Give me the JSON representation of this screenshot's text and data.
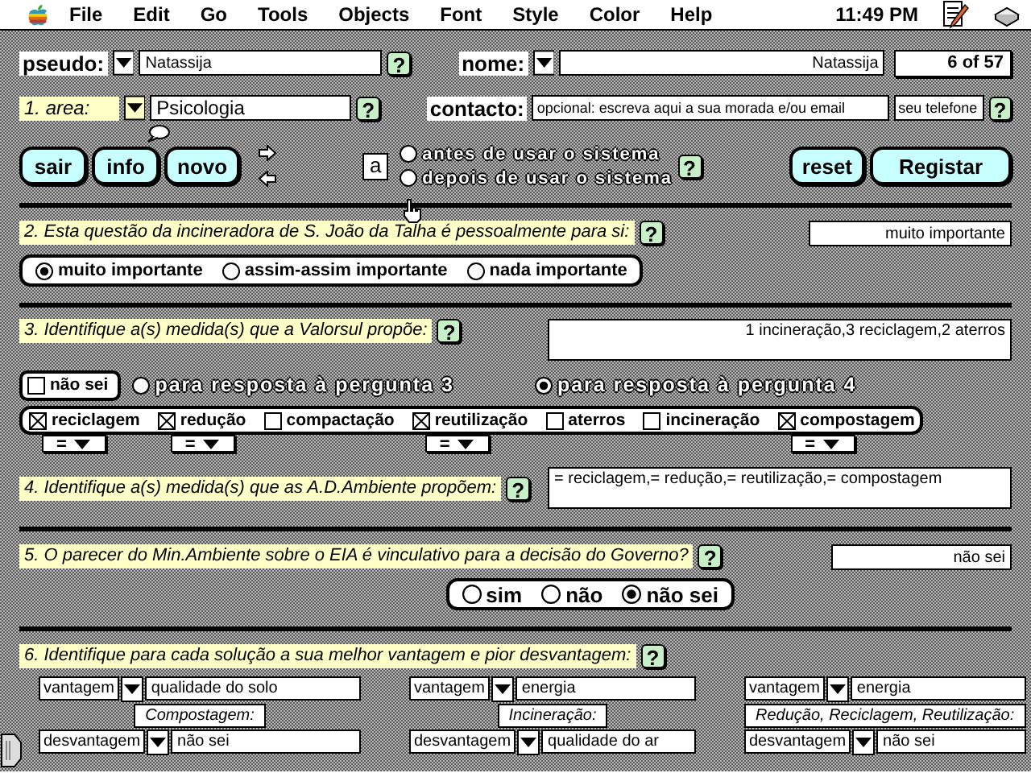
{
  "menubar": {
    "menus": [
      "File",
      "Edit",
      "Go",
      "Tools",
      "Objects",
      "Font",
      "Style",
      "Color",
      "Help"
    ],
    "clock": "11:49 PM"
  },
  "identity": {
    "pseudo_label": "pseudo:",
    "pseudo": "Natassija",
    "pseudo_help": "?",
    "nome_label": "nome:",
    "nome": "Natassija",
    "record_counter": "6 of 57"
  },
  "area": {
    "label": "1. area:",
    "value": "Psicologia",
    "help": "?"
  },
  "contacto": {
    "label": "contacto:",
    "address": "opcional: escreva aqui a sua morada e/ou email",
    "phone": "seu telefone",
    "help": "?"
  },
  "actions": [
    "sair",
    "info",
    "novo"
  ],
  "timing": {
    "marker": "a",
    "help": "?",
    "options": [
      {
        "label": "antes de usar o sistema",
        "selected": false
      },
      {
        "label": "depois de usar o sistema",
        "selected": false
      }
    ]
  },
  "right_actions": [
    "reset",
    "Registar"
  ],
  "q2": {
    "text": "2. Esta questão da incineradora de S. João da Talha é pessoalmente para si:",
    "help": "?",
    "answer": "muito importante",
    "options": [
      {
        "label": "muito importante",
        "selected": true
      },
      {
        "label": "assim-assim importante",
        "selected": false
      },
      {
        "label": "nada importante",
        "selected": false
      }
    ]
  },
  "q3": {
    "text": "3. Identifique a(s) medida(s) que a Valorsul propõe:",
    "help": "?",
    "answer": "1 incineração,3 reciclagem,2 aterros"
  },
  "measures": {
    "nao_sei": {
      "label": "não sei",
      "checked": false
    },
    "targets": [
      {
        "label": "para resposta à pergunta 3",
        "selected": false
      },
      {
        "label": "para resposta à pergunta 4",
        "selected": true
      }
    ],
    "items": [
      {
        "label": "reciclagem",
        "checked": true,
        "operator": "="
      },
      {
        "label": "redução",
        "checked": true,
        "operator": "="
      },
      {
        "label": "compactação",
        "checked": false
      },
      {
        "label": "reutilização",
        "checked": true,
        "operator": "="
      },
      {
        "label": "aterros",
        "checked": false
      },
      {
        "label": "incineração",
        "checked": false
      },
      {
        "label": "compostagem",
        "checked": true,
        "operator": "="
      }
    ]
  },
  "q4": {
    "text": "4. Identifique a(s) medida(s) que as A.D.Ambiente propõem:",
    "help": "?",
    "answer": "= reciclagem,= redução,= reutilização,= compostagem"
  },
  "q5": {
    "text": "5. O parecer do Min.Ambiente sobre o EIA é vinculativo para a decisão do Governo?",
    "help": "?",
    "answer": "não sei",
    "options": [
      {
        "label": "sim",
        "selected": false
      },
      {
        "label": "não",
        "selected": false
      },
      {
        "label": "não sei",
        "selected": true
      }
    ]
  },
  "q6": {
    "text": "6. Identifique para cada solução a sua melhor vantagem e pior desvantagem:",
    "help": "?",
    "solutions": [
      {
        "vantagem_label": "vantagem",
        "vantagem": "qualidade do solo",
        "name": "Compostagem:",
        "desvantagem_label": "desvantagem",
        "desvantagem": "não sei"
      },
      {
        "vantagem_label": "vantagem",
        "vantagem": "energia",
        "name": "Incineração:",
        "desvantagem_label": "desvantagem",
        "desvantagem": "qualidade do ar"
      },
      {
        "vantagem_label": "vantagem",
        "vantagem": "energia",
        "name": "Redução, Reciclagem, Reutilização:",
        "desvantagem_label": "desvantagem",
        "desvantagem": "não sei"
      }
    ]
  }
}
